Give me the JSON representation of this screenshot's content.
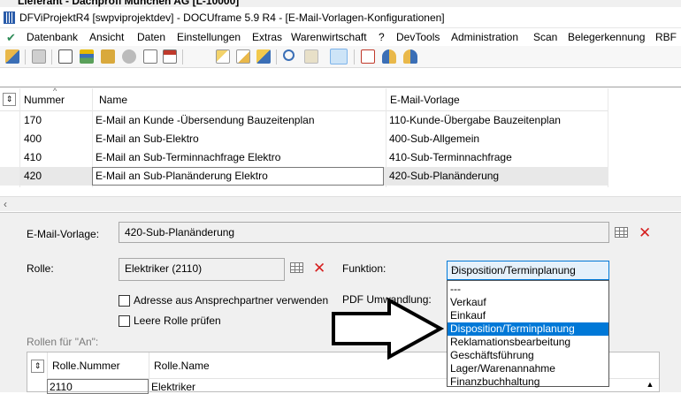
{
  "parent_window": {
    "title_fragment": "Lieferant  -  Dachprofi München AG [L-10000]"
  },
  "window": {
    "title": "DFViProjektR4 [swpviprojektdev] - DOCUframe 5.9 R4 - [E-Mail-Vorlagen-Konfigurationen]"
  },
  "menu": {
    "items": [
      "Datenbank",
      "Ansicht",
      "Daten",
      "Einstellungen",
      "Extras",
      "Warenwirtschaft",
      "?",
      "DevTools",
      "Administration",
      "Scan",
      "Belegerkennung",
      "RBF"
    ]
  },
  "toolbar": {
    "icons": [
      "open-icon",
      "print-icon",
      "card-icon",
      "list-icon",
      "folder-icon",
      "tag-icon",
      "doc-icon",
      "calendar-icon",
      "new-doc-icon",
      "edit-doc-icon",
      "export-icon",
      "search-icon",
      "find-icon",
      "view-icon",
      "pdf-icon",
      "users-icon",
      "user-settings-icon"
    ]
  },
  "top_table": {
    "columns": [
      "Nummer",
      "Name",
      "E-Mail-Vorlage"
    ],
    "rows": [
      {
        "nummer": "170",
        "name": "E-Mail an Kunde -Übersendung Bauzeitenplan",
        "vorlage": "110-Kunde-Übergabe Bauzeitenplan"
      },
      {
        "nummer": "400",
        "name": "E-Mail an Sub-Elektro",
        "vorlage": "400-Sub-Allgemein"
      },
      {
        "nummer": "410",
        "name": "E-Mail an Sub-Terminnachfrage Elektro",
        "vorlage": "410-Sub-Terminnachfrage"
      },
      {
        "nummer": "420",
        "name": "E-Mail an Sub-Planänderung Elektro",
        "vorlage": "420-Sub-Planänderung"
      }
    ],
    "selected_row": 3
  },
  "detail": {
    "email_vorlage_label": "E-Mail-Vorlage:",
    "email_vorlage_value": "420-Sub-Planänderung",
    "rolle_label": "Rolle:",
    "rolle_value": "Elektriker (2110)",
    "funktion_label": "Funktion:",
    "funktion_value": "Disposition/Terminplanung",
    "adresse_checkbox_label": "Adresse aus Ansprechpartner verwenden",
    "adresse_checked": false,
    "pdf_label": "PDF Umwandlung:",
    "leere_rolle_label": "Leere Rolle prüfen",
    "leere_rolle_checked": false,
    "rollen_an_label": "Rollen für \"An\":"
  },
  "funktion_options": [
    "---",
    "Verkauf",
    "Einkauf",
    "Disposition/Terminplanung",
    "Reklamationsbearbeitung",
    "Geschäftsführung",
    "Lager/Warenannahme",
    "Finanzbuchhaltung"
  ],
  "funktion_highlighted_index": 3,
  "roles_table": {
    "columns": [
      "Rolle.Nummer",
      "Rolle.Name"
    ],
    "rows": [
      {
        "nummer": "2110",
        "name": "Elektriker"
      }
    ]
  },
  "colors": {
    "selection": "#0078d7",
    "delete_red": "#d62020",
    "panel_bg": "#f0f0f0"
  }
}
